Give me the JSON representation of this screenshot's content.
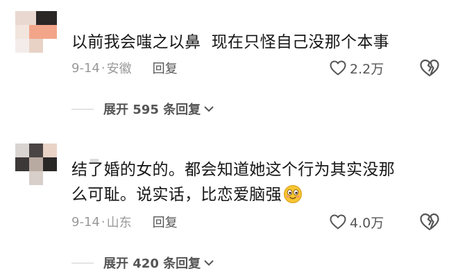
{
  "comments": [
    {
      "text": "以前我会嗤之以鼻  现在只怪自己没那个本事",
      "text_line2": "",
      "date": "9-14",
      "separator": "·",
      "location": "安徽",
      "reply_label": "回复",
      "likes": "2.2万",
      "expand_label": "展开 595 条回复"
    },
    {
      "text": "结了婚的女的。都会知道她这个行为其实没那",
      "text_line2": "么可耻。说实话，比恋爱脑强",
      "date": "9-14",
      "separator": "·",
      "location": "山东",
      "reply_label": "回复",
      "likes": "4.0万",
      "expand_label": "展开 420 条回复"
    }
  ],
  "icons": {
    "like": "heart-outline-icon",
    "dislike": "broken-heart-icon",
    "expand": "chevron-down-icon",
    "emoji": "smiling-face-emoji"
  },
  "colors": {
    "text": "#161616",
    "meta": "#9a9a9a",
    "secondary": "#555555",
    "emoji": "#f7c531"
  }
}
